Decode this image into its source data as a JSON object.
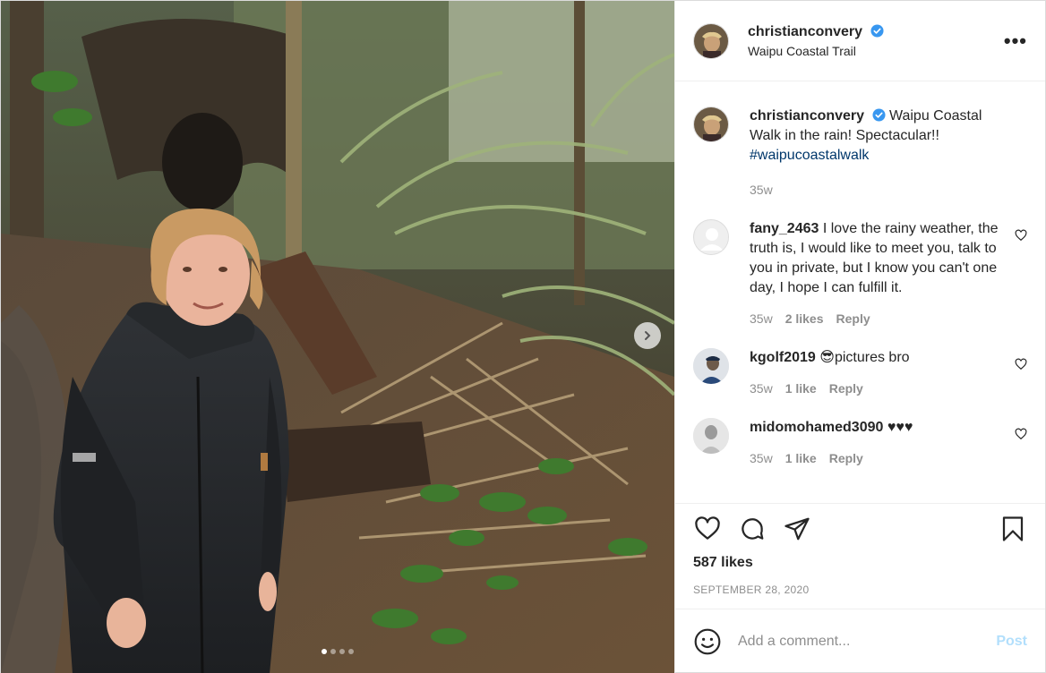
{
  "header": {
    "username": "christianconvery",
    "location": "Waipu Coastal Trail",
    "more_label": "•••"
  },
  "caption": {
    "username": "christianconvery",
    "text": "Waipu Coastal Walk in the rain! Spectacular!!",
    "hashtag": "#waipucoastalwalk",
    "time": "35w"
  },
  "comments": [
    {
      "username": "fany_2463",
      "text": "I love the rainy weather, the truth is, I would like to meet you, talk to you in private, but I know you can't one day, I hope I can fulfill it.",
      "time": "35w",
      "likes": "2 likes",
      "reply": "Reply"
    },
    {
      "username": "kgolf2019",
      "text": "😎pictures bro",
      "time": "35w",
      "likes": "1 like",
      "reply": "Reply"
    },
    {
      "username": "midomohamed3090",
      "text": "♥♥♥",
      "time": "35w",
      "likes": "1 like",
      "reply": "Reply"
    }
  ],
  "actions": {
    "likes": "587 likes",
    "date": "SEPTEMBER 28, 2020"
  },
  "add_comment": {
    "placeholder": "Add a comment...",
    "post_label": "Post"
  },
  "carousel": {
    "slides": 4,
    "active": 0
  },
  "colors": {
    "verified": "#3897f0",
    "hashtag": "#00376b",
    "post_disabled": "#b2dffc",
    "muted": "#8e8e8e"
  }
}
